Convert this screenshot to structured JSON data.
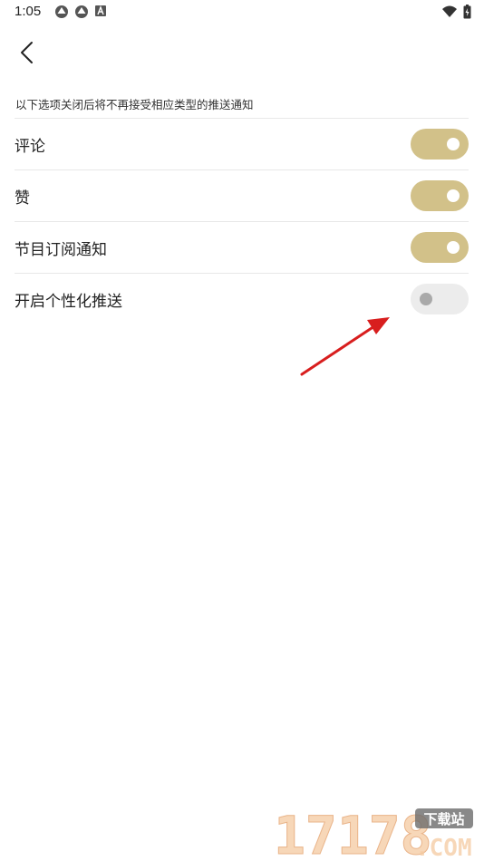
{
  "status_bar": {
    "time": "1:05"
  },
  "header": {
    "back_icon": "chevron-left-icon"
  },
  "hint_text": "以下选项关闭后将不再接受相应类型的推送通知",
  "settings": [
    {
      "label": "评论",
      "enabled": true
    },
    {
      "label": "赞",
      "enabled": true
    },
    {
      "label": "节目订阅通知",
      "enabled": true
    },
    {
      "label": "开启个性化推送",
      "enabled": false
    }
  ],
  "colors": {
    "toggle_on": "#d2c189",
    "toggle_off": "#ececec",
    "annotation_arrow": "#d81e1e"
  },
  "watermark": {
    "number": "17178",
    "badge": "下载站",
    "domain": ".COM"
  }
}
